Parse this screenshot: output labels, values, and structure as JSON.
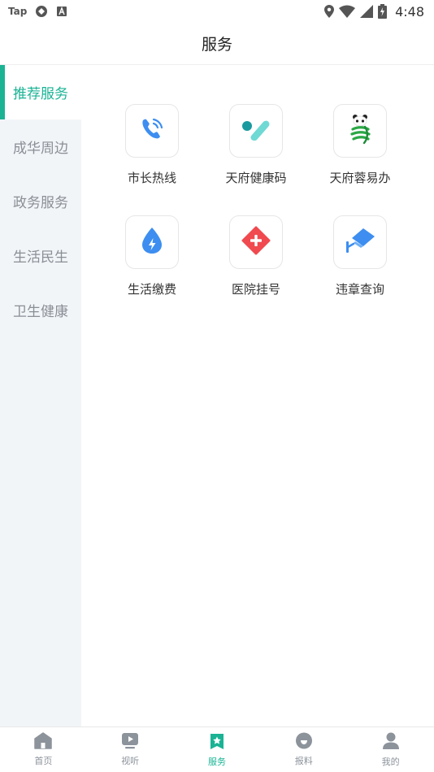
{
  "status_bar": {
    "left_items": [
      "Tap"
    ],
    "time": "4:48"
  },
  "header": {
    "title": "服务"
  },
  "sidebar": {
    "items": [
      {
        "label": "推荐服务",
        "active": true
      },
      {
        "label": "成华周边",
        "active": false
      },
      {
        "label": "政务服务",
        "active": false
      },
      {
        "label": "生活民生",
        "active": false
      },
      {
        "label": "卫生健康",
        "active": false
      }
    ]
  },
  "services": [
    {
      "label": "市长热线",
      "icon": "phone-icon",
      "color": "#3d8ef0"
    },
    {
      "label": "天府健康码",
      "icon": "health-code-icon",
      "color": "#24b5b0"
    },
    {
      "label": "天府蓉易办",
      "icon": "panda-icon",
      "color": "#2aa745"
    },
    {
      "label": "生活缴费",
      "icon": "water-drop-icon",
      "color": "#3d8ef0"
    },
    {
      "label": "医院挂号",
      "icon": "hospital-cross-icon",
      "color": "#f0494f"
    },
    {
      "label": "违章查询",
      "icon": "camera-icon",
      "color": "#3d8ef0"
    }
  ],
  "bottom_nav": {
    "items": [
      {
        "label": "首页",
        "icon": "home-icon",
        "active": false
      },
      {
        "label": "视听",
        "icon": "video-icon",
        "active": false
      },
      {
        "label": "服务",
        "icon": "service-star-icon",
        "active": true
      },
      {
        "label": "报料",
        "icon": "report-icon",
        "active": false
      },
      {
        "label": "我的",
        "icon": "profile-icon",
        "active": false
      }
    ]
  },
  "colors": {
    "accent": "#1ab394",
    "sidebar_bg": "#f2f5f8",
    "inactive": "#8c939b"
  }
}
